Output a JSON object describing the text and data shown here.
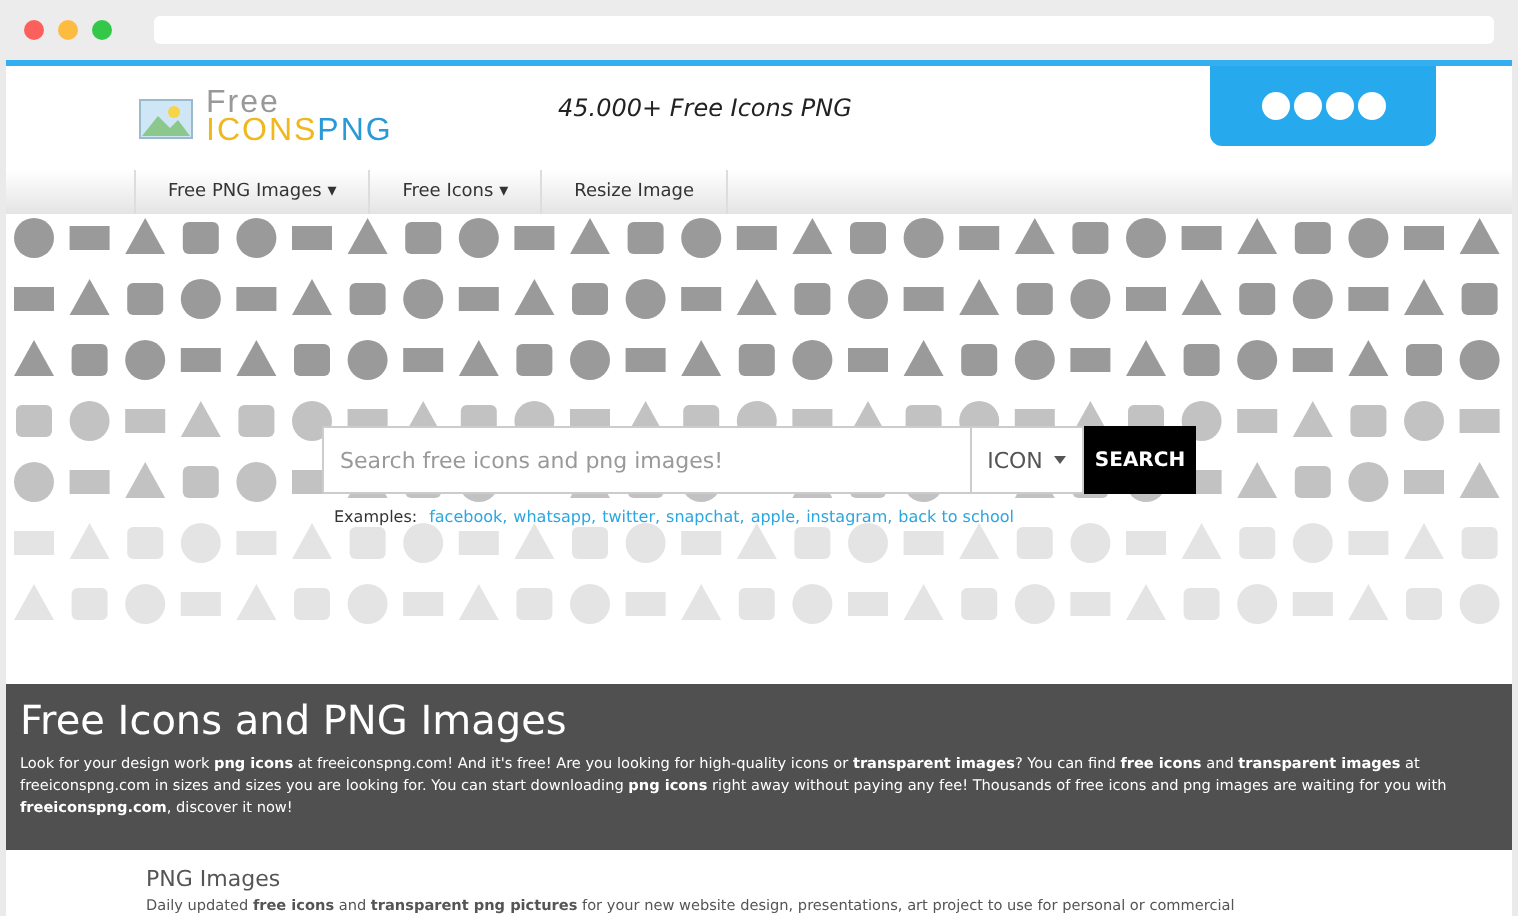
{
  "header": {
    "logo": {
      "word_1": "Free",
      "word_2": "ICONS",
      "word_3": "PNG"
    },
    "tagline": "45.000+ Free Icons PNG"
  },
  "nav": [
    {
      "label": "Free PNG Images",
      "caret": "▾"
    },
    {
      "label": "Free Icons",
      "caret": "▾"
    },
    {
      "label": "Resize Image"
    }
  ],
  "search": {
    "placeholder": "Search free icons and png images!",
    "type_select": "ICON",
    "button": "SEARCH",
    "examples_label": "Examples:",
    "examples": [
      "facebook,",
      "whatsapp,",
      "twitter,",
      "snapchat,",
      "apple,",
      "instagram,",
      "back to school"
    ]
  },
  "intro": {
    "title": "Free Icons and PNG Images",
    "text": "Look for your design work **png icons** at freeiconspng.com! And it's free! Are you looking for high-quality icons or **transparent images**? You can find **free icons** and **transparent images** at freeiconspng.com in sizes and sizes you are looking for. You can start downloading **png icons** right away without paying any fee! Thousands of free icons and png images are waiting for you with **freeiconspng.com**, discover it now!"
  },
  "section": {
    "title": "PNG Images",
    "text": "Daily updated **free icons** and **transparent png pictures** for your new website design, presentations, art project to use for personal or commercial"
  }
}
